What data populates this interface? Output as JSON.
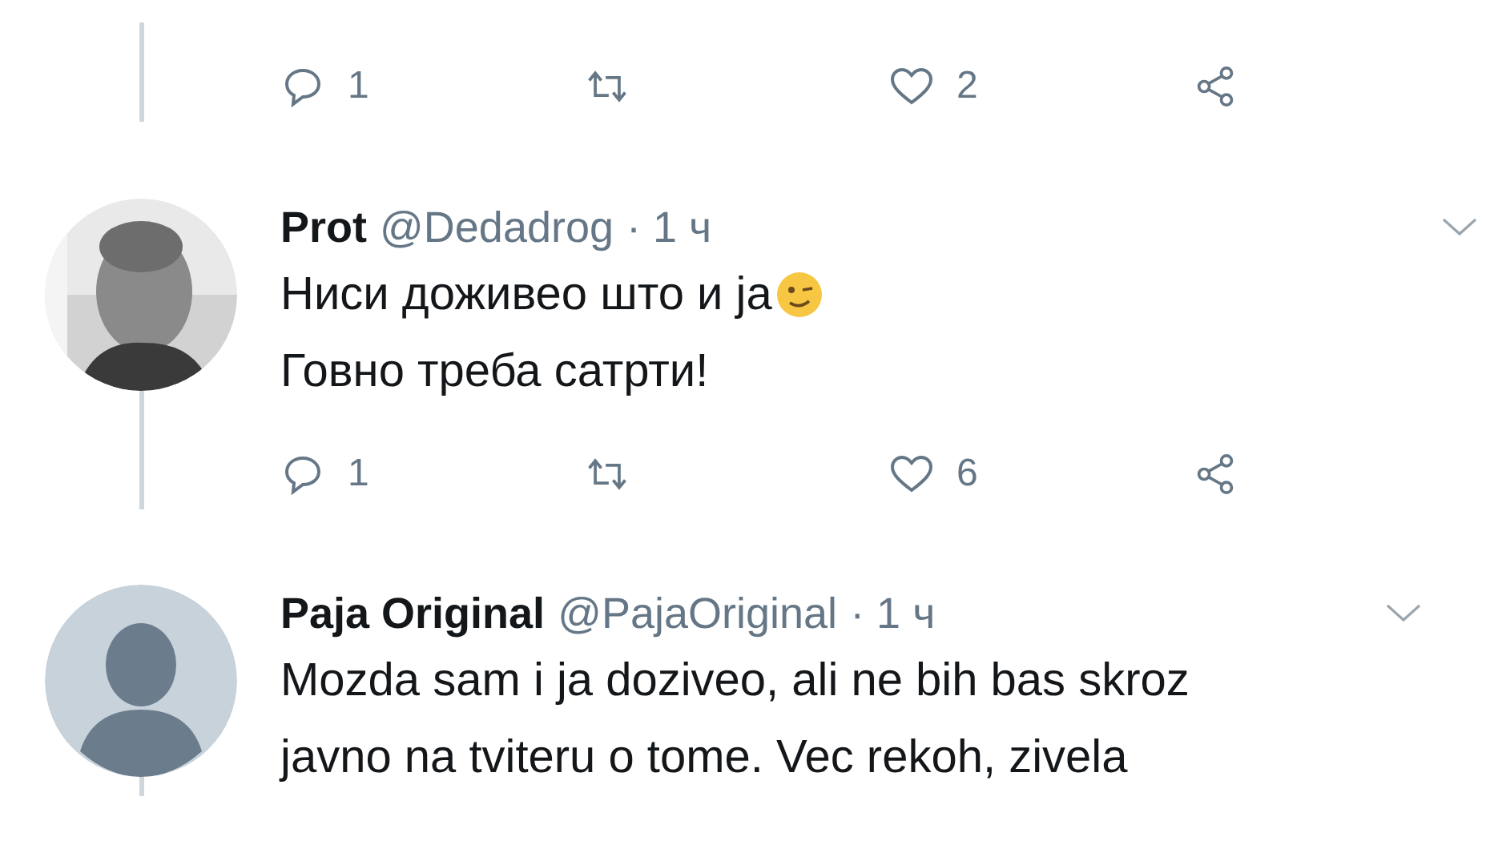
{
  "tweets": [
    {
      "actions": {
        "replies": "1",
        "likes": "2"
      }
    },
    {
      "avatar": {
        "kind": "photo"
      },
      "name": "Prot",
      "handle": "@Dedadrog",
      "time": "· 1 ч",
      "lines": [
        {
          "text": "Ниси доживео што и ја",
          "emoji": true
        },
        {
          "text": "Говно треба сатрти!"
        }
      ],
      "actions": {
        "replies": "1",
        "likes": "6"
      }
    },
    {
      "avatar": {
        "kind": "default"
      },
      "name": "Paja Original",
      "handle": "@PajaOriginal",
      "time": "· 1 ч",
      "lines": [
        {
          "text": "Mozda sam i ja doziveo, ali ne bih bas skroz"
        },
        {
          "text": "javno na tviteru o tome. Vec rekoh, zivela"
        }
      ]
    }
  ]
}
